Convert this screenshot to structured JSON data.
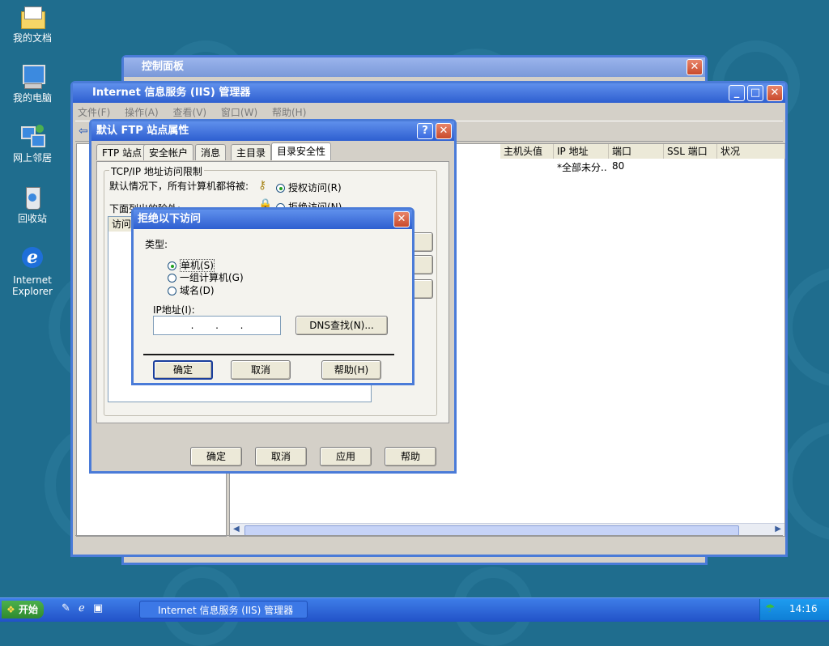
{
  "desktop": {
    "icons": [
      {
        "label": "我的文档",
        "icon": "folder-icon"
      },
      {
        "label": "我的电脑",
        "icon": "computer-icon"
      },
      {
        "label": "网上邻居",
        "icon": "network-icon"
      },
      {
        "label": "回收站",
        "icon": "recycle-bin-icon"
      },
      {
        "label": "Internet Explorer",
        "icon": "ie-icon"
      }
    ]
  },
  "control_panel": {
    "title": "控制面板"
  },
  "iis": {
    "title": "Internet 信息服务 (IIS) 管理器",
    "menu": [
      "文件(F)",
      "操作(A)",
      "查看(V)",
      "窗口(W)",
      "帮助(H)"
    ],
    "columns": [
      "主机头值",
      "IP 地址",
      "端口",
      "SSL 端口",
      "状况"
    ],
    "row": {
      "ip": "*全部未分..",
      "port": "80"
    }
  },
  "ftp_props": {
    "title": "默认 FTP 站点属性",
    "tabs": [
      "FTP 站点",
      "安全帐户",
      "消息",
      "主目录",
      "目录安全性"
    ],
    "active_tab": 4,
    "group_label": "TCP/IP 地址访问限制",
    "default_text": "默认情况下，所有计算机都将被:",
    "grant_label": "授权访问(R)",
    "deny_label": "拒绝访问(N)",
    "exceptions_label": "下面列出的除外:",
    "list_col": "访问",
    "buttons": {
      "ok": "确定",
      "cancel": "取消",
      "apply": "应用",
      "help": "帮助"
    }
  },
  "deny_dialog": {
    "title": "拒绝以下访问",
    "type_label": "类型:",
    "options": [
      "单机(S)",
      "一组计算机(G)",
      "域名(D)"
    ],
    "selected": 0,
    "ip_label": "IP地址(I):",
    "ip_value": ".       .       .",
    "dns_button": "DNS查找(N)...",
    "buttons": {
      "ok": "确定",
      "cancel": "取消",
      "help": "帮助(H)"
    }
  },
  "taskbar": {
    "start": "开始",
    "task": "Internet 信息服务 (IIS) 管理器",
    "clock": "14:16"
  }
}
